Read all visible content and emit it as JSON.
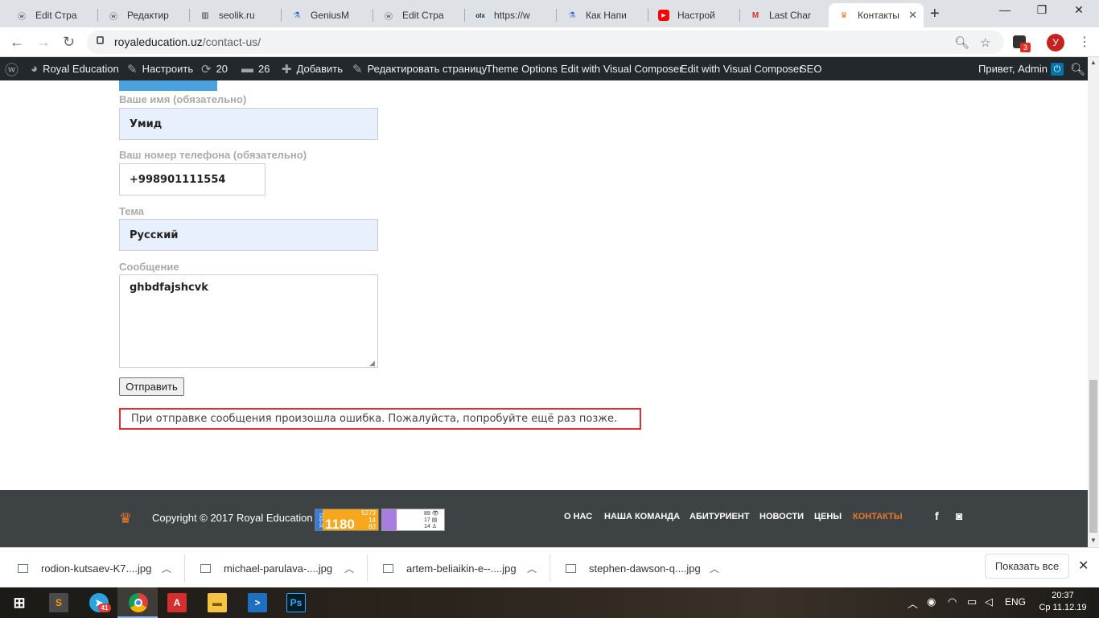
{
  "browser": {
    "tabs": [
      {
        "title": "Edit Стра",
        "icon": "wordpress-icon"
      },
      {
        "title": "Редактир",
        "icon": "wordpress-icon"
      },
      {
        "title": "seolik.ru",
        "icon": "chart-icon"
      },
      {
        "title": "GeniusM",
        "icon": "flask-icon"
      },
      {
        "title": "Edit Стра",
        "icon": "wordpress-icon"
      },
      {
        "title": "https://w",
        "icon": "olx-icon"
      },
      {
        "title": "Как Напи",
        "icon": "flask-icon"
      },
      {
        "title": "Настрой",
        "icon": "youtube-icon"
      },
      {
        "title": "Last Char",
        "icon": "gmail-icon"
      },
      {
        "title": "Контакты",
        "icon": "crown-icon"
      }
    ],
    "url_domain": "royaleducation.uz",
    "url_path": "/contact-us/",
    "profile_initial": "У",
    "extension_badge": "3"
  },
  "adminbar": {
    "site_name": "Royal Education",
    "customize": "Настроить",
    "updates_count": "20",
    "comments_count": "26",
    "add_new": "Добавить",
    "edit_page": "Редактировать страницу",
    "theme_options": "Theme Options",
    "edit_vc_1": "Edit with Visual Composer",
    "edit_vc_2": "Edit with Visual Composer",
    "seo": "SEO",
    "greeting": "Привет, Admin"
  },
  "form": {
    "name_label": "Ваше имя (обязательно)",
    "name_value": "Умид",
    "phone_label": "Ваш номер телефона (обязательно)",
    "phone_value": "+998901111554",
    "subject_label": "Тема",
    "subject_value": "Русский",
    "message_label": "Сообщение",
    "message_value": "ghbdfajshcvk",
    "submit_label": "Отправить",
    "error_message": "При отправке сообщения произошла ошибка. Пожалуйста, попробуйте ещё раз позже."
  },
  "footer": {
    "copyright": "Copyright © 2017 Royal Education",
    "counter1": {
      "side": "TAS-IX",
      "big": "1180",
      "lines": [
        "5273",
        "14",
        "83"
      ]
    },
    "counter2": {
      "lines": [
        "89 👁",
        "17 ▤",
        "14 ♙"
      ]
    },
    "nav": [
      "О НАС",
      "НАША КОМАНДА",
      "АБИТУРИЕНТ",
      "НОВОСТИ",
      "ЦЕНЫ",
      "КОНТАКТЫ"
    ],
    "active_nav": "КОНТАКТЫ",
    "social": [
      "facebook-icon",
      "instagram-icon"
    ]
  },
  "downloads": {
    "items": [
      "rodion-kutsaev-K7....jpg",
      "michael-parulava-....jpg",
      "artem-beliaikin-e--....jpg",
      "stephen-dawson-q....jpg"
    ],
    "show_all": "Показать все"
  },
  "taskbar": {
    "telegram_badge": "41",
    "language": "ENG",
    "time": "20:37",
    "date": "Ср 11.12.19"
  },
  "colors": {
    "accent_orange": "#e8792b",
    "error_red": "#dc3232",
    "admin_bar": "#23282d",
    "footer_bg": "#3d4245",
    "autofill_blue": "#e8f0fe"
  }
}
